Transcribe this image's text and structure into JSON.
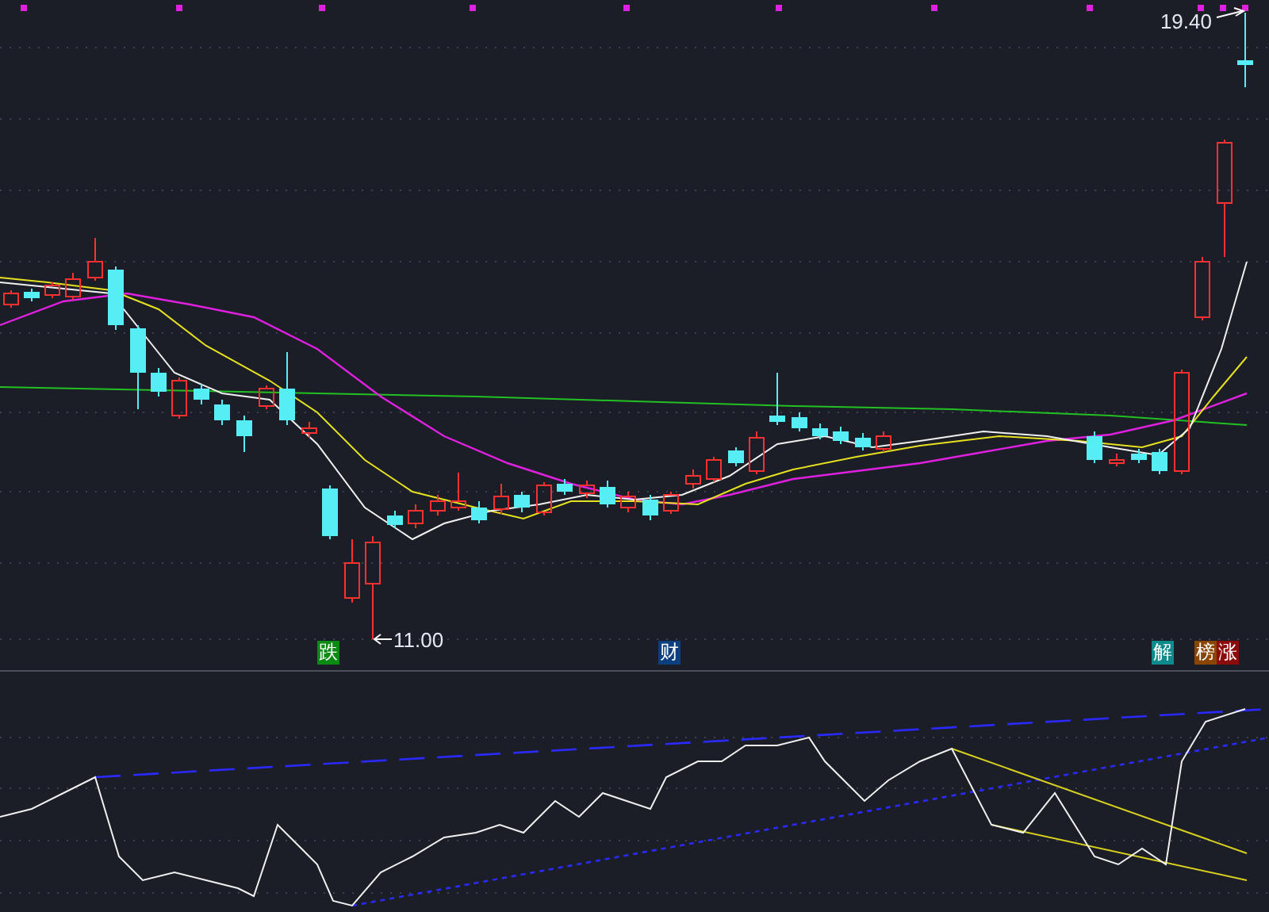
{
  "price_chart": {
    "high_label": "19.40",
    "low_label": "11.00",
    "signals": [
      {
        "text": "跌",
        "color": "#0b8a14"
      },
      {
        "text": "财",
        "color": "#0b3f7f"
      },
      {
        "text": "解",
        "color": "#0e8a8c"
      },
      {
        "text": "榜",
        "color": "#8a4600"
      },
      {
        "text": "涨",
        "color": "#8c0b0b"
      }
    ]
  }
}
